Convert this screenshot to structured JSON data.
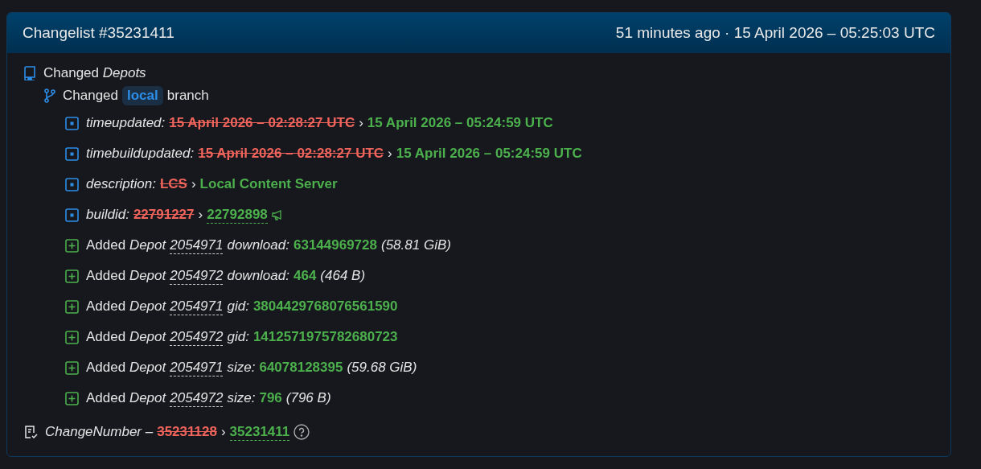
{
  "header": {
    "title": "Changelist #35231411",
    "time": "51 minutes ago · 15 April 2026 – 05:25:03 UTC"
  },
  "section": {
    "verb": "Changed",
    "name": "Depots"
  },
  "branch": {
    "verb": "Changed",
    "name": "local",
    "suffix": "branch"
  },
  "changes": [
    {
      "kind": "changed",
      "key": "timeupdated:",
      "old": "15 April 2026 – 02:28:27 UTC",
      "arrow": "›",
      "new": "15 April 2026 – 05:24:59 UTC",
      "linked": false,
      "announce": false
    },
    {
      "kind": "changed",
      "key": "timebuildupdated:",
      "old": "15 April 2026 – 02:28:27 UTC",
      "arrow": "›",
      "new": "15 April 2026 – 05:24:59 UTC",
      "linked": false,
      "announce": false
    },
    {
      "kind": "changed",
      "key": "description:",
      "old": "LCS",
      "arrow": "›",
      "new": "Local Content Server",
      "linked": false,
      "announce": false
    },
    {
      "kind": "changed",
      "key": "buildid:",
      "old": "22791227",
      "arrow": "›",
      "new": "22792898",
      "linked": true,
      "announce": true
    },
    {
      "kind": "added",
      "verb": "Added",
      "label": "Depot",
      "depot": "2054971",
      "key": "download:",
      "value": "63144969728",
      "note": "(58.81 GiB)"
    },
    {
      "kind": "added",
      "verb": "Added",
      "label": "Depot",
      "depot": "2054972",
      "key": "download:",
      "value": "464",
      "note": "(464 B)"
    },
    {
      "kind": "added",
      "verb": "Added",
      "label": "Depot",
      "depot": "2054971",
      "key": "gid:",
      "value": "3804429768076561590"
    },
    {
      "kind": "added",
      "verb": "Added",
      "label": "Depot",
      "depot": "2054972",
      "key": "gid:",
      "value": "1412571975782680723"
    },
    {
      "kind": "added",
      "verb": "Added",
      "label": "Depot",
      "depot": "2054971",
      "key": "size:",
      "value": "64078128395",
      "note": "(59.68 GiB)"
    },
    {
      "kind": "added",
      "verb": "Added",
      "label": "Depot",
      "depot": "2054972",
      "key": "size:",
      "value": "796",
      "note": "(796 B)"
    }
  ],
  "footer": {
    "key": "ChangeNumber",
    "sep": "–",
    "old": "35231128",
    "arrow": "›",
    "new": "35231411"
  }
}
